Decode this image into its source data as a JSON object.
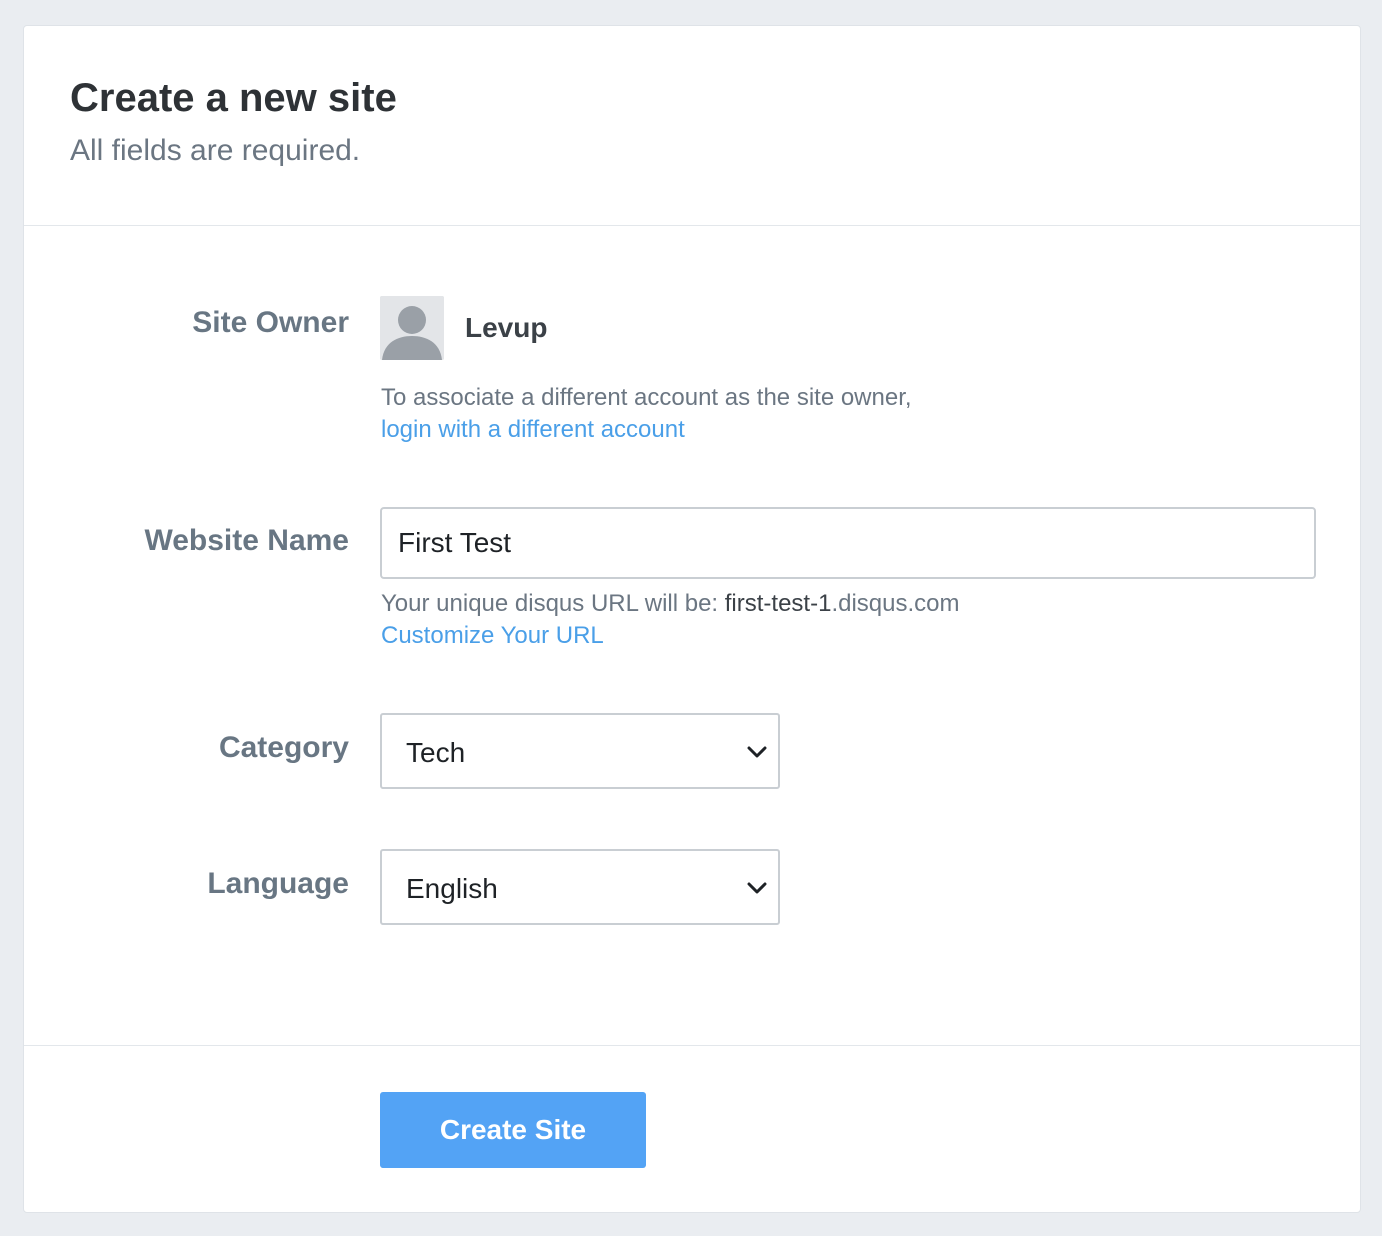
{
  "header": {
    "title": "Create a new site",
    "subtitle": "All fields are required."
  },
  "site_owner": {
    "label": "Site Owner",
    "avatar_icon": "user-silhouette-icon",
    "username": "Levup",
    "help_text": "To associate a different account as the site owner,",
    "link_text": "login with a different account"
  },
  "website_name": {
    "label": "Website Name",
    "value": "First Test",
    "url_prefix": "Your unique disqus URL will be: ",
    "url_slug": "first-test-1",
    "url_suffix": ".disqus.com",
    "customize_link": "Customize Your URL"
  },
  "category": {
    "label": "Category",
    "selected": "Tech",
    "icon": "chevron-down-icon"
  },
  "language": {
    "label": "Language",
    "selected": "English",
    "icon": "chevron-down-icon"
  },
  "footer": {
    "create_button": "Create Site"
  },
  "colors": {
    "accent": "#53a3f5",
    "link": "#4a9fe8",
    "background": "#eaedf1"
  }
}
